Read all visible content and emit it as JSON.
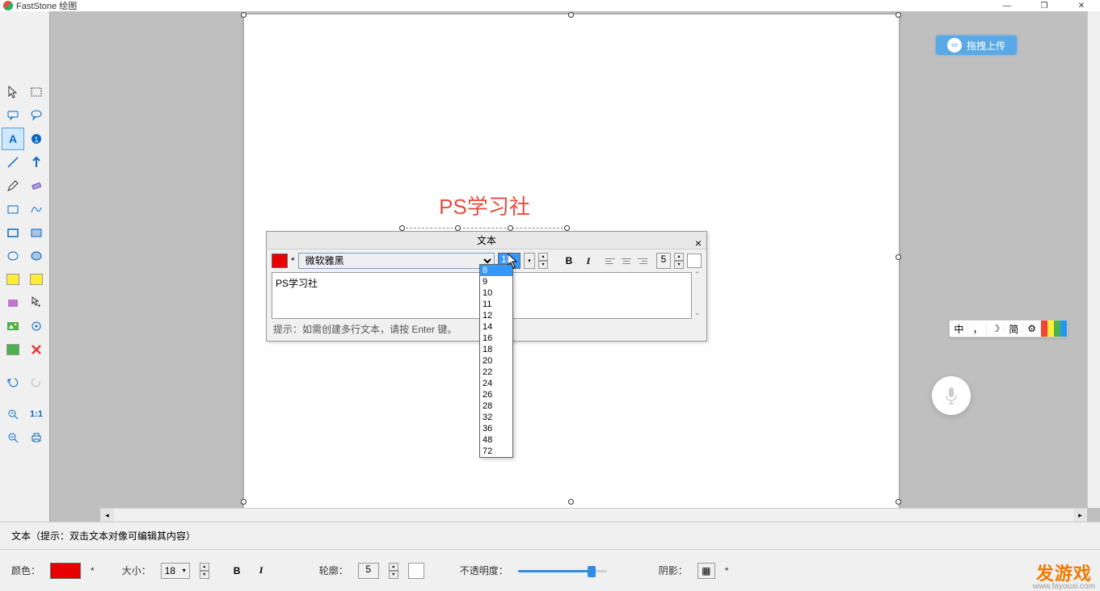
{
  "app": {
    "title": "FastStone 绘图"
  },
  "canvas_text": "PS学习社",
  "text_dialog": {
    "title": "文本",
    "font": "微软雅黑",
    "size_value": "18",
    "spacing_value": "5",
    "close": "×",
    "asterisk": "*",
    "textarea_value": "PS学习社",
    "hint": "提示：如需创建多行文本，请按 Enter 键。"
  },
  "size_options": [
    "8",
    "9",
    "10",
    "11",
    "12",
    "14",
    "16",
    "18",
    "20",
    "22",
    "24",
    "26",
    "28",
    "32",
    "36",
    "48",
    "72"
  ],
  "size_selected": "8",
  "upload": {
    "label": "拖拽上传",
    "icon_glyph": "∞"
  },
  "ime": {
    "lang": "中",
    "punct": "，",
    "moon": "☽",
    "mode": "简",
    "gear": "⚙"
  },
  "status": {
    "text": "文本（提示：双击文本对像可编辑其内容）"
  },
  "bottom": {
    "color_label": "颜色：",
    "asterisk": "*",
    "size_label": "大小：",
    "size_value": "18",
    "bold": "B",
    "italic": "I",
    "outline_label": "轮廓：",
    "outline_value": "5",
    "opacity_label": "不透明度：",
    "shadow_label": "阴影：",
    "shadow_glyph": "▦"
  },
  "watermark": {
    "brand": "发游戏",
    "url": "www.fayouxi.com"
  }
}
